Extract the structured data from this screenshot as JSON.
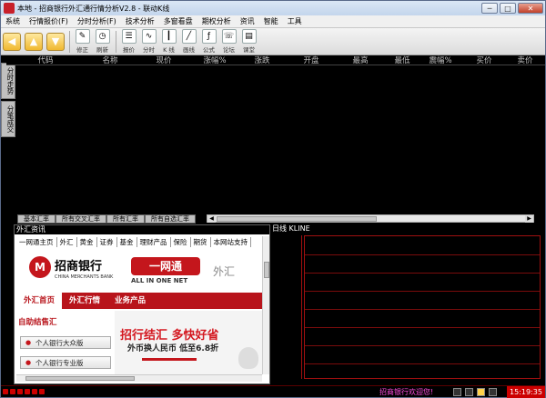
{
  "window": {
    "title": "本地 - 招商银行外汇通行情分析V2.8 - 联动K线"
  },
  "menu": [
    "系统",
    "行情报价(F)",
    "分时分析(F)",
    "技术分析",
    "多窗看盘",
    "期权分析",
    "资讯",
    "智能",
    "工具"
  ],
  "toolbar": [
    {
      "label": "修正",
      "icon": "pen-icon"
    },
    {
      "label": "刷新",
      "icon": "clock-icon"
    },
    {
      "label": "报价",
      "icon": "list-icon"
    },
    {
      "label": "分时",
      "icon": "line-icon"
    },
    {
      "label": "K 线",
      "icon": "kline-icon"
    },
    {
      "label": "画线",
      "icon": "draw-icon"
    },
    {
      "label": "公式",
      "icon": "formula-icon"
    },
    {
      "label": "论坛",
      "icon": "forum-icon"
    },
    {
      "label": "课堂",
      "icon": "class-icon"
    }
  ],
  "quote_headers": [
    "代码",
    "名称",
    "现价",
    "涨幅%",
    "涨跌",
    "开盘",
    "最高",
    "最低",
    "震幅%",
    "买价",
    "卖价"
  ],
  "side_tabs": [
    "分时走势",
    "分笔成交"
  ],
  "quote_tabs": [
    "基本汇率",
    "所有交叉汇率",
    "所有汇率",
    "所有自选汇率"
  ],
  "fx_panel": {
    "header": "外汇资讯",
    "nav": [
      "一网通主页",
      "外汇",
      "黄金",
      "证券",
      "基金",
      "理财产品",
      "保险",
      "期货",
      "本网站支持"
    ],
    "bank_name": "招商银行",
    "bank_sub": "CHINA MERCHANTS BANK",
    "onenet": "一网通",
    "onenet_sub": "ALL IN ONE NET",
    "fx_label": "外汇",
    "tabs": [
      "外汇首页",
      "外汇行情",
      "业务产品"
    ],
    "quick": "自助结售汇",
    "btn1": "个人银行大众版",
    "btn2": "个人银行专业版",
    "ad_title": "招行结汇 多快好省",
    "ad_sub": "外币换人民币 低至6.8折"
  },
  "kline": {
    "header": "日线 KLINE"
  },
  "status": {
    "message": "招商银行欢迎您!",
    "time": "15:19:35"
  }
}
